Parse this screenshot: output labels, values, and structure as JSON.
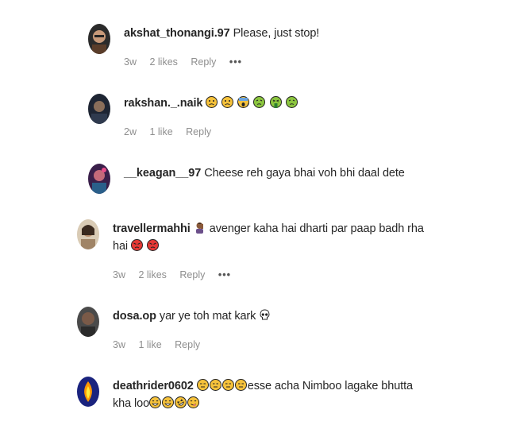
{
  "comments": [
    {
      "username": "akshat_thonangi.97",
      "text": "Please, just stop!",
      "time": "3w",
      "likes": "2 likes",
      "reply": "Reply",
      "more": "•••"
    },
    {
      "username": "rakshan._.naik",
      "text": "",
      "time": "2w",
      "likes": "1 like",
      "reply": "Reply"
    },
    {
      "username": "__keagan__97",
      "text": "Cheese reh gaya bhai voh bhi daal dete"
    },
    {
      "username": "travellermahhi",
      "text": "avenger kaha hai dharti par paap badh rha",
      "text2": "hai",
      "time": "3w",
      "likes": "2 likes",
      "reply": "Reply",
      "more": "•••"
    },
    {
      "username": "dosa.op",
      "text": "yar ye toh mat kark",
      "time": "3w",
      "likes": "1 like",
      "reply": "Reply"
    },
    {
      "username": "deathrider0602",
      "text": "esse acha Nimboo lagake bhutta",
      "text2": "kha loo"
    }
  ],
  "emoji": {
    "rakshan": [
      "sad-face",
      "sad-face",
      "screaming-face",
      "nauseated-face",
      "vomiting-face",
      "nauseated-face"
    ],
    "traveller_inline": [
      "person-facepalming"
    ],
    "traveller_end": [
      "angry-face",
      "angry-face"
    ],
    "dosa": [
      "skull"
    ],
    "deathrider_start": [
      "expressionless-face",
      "expressionless-face",
      "expressionless-face",
      "expressionless-face"
    ],
    "deathrider_end": [
      "grinning-sweat-face",
      "grinning-sweat-face",
      "rolling-laughing-face",
      "yum-face"
    ]
  }
}
